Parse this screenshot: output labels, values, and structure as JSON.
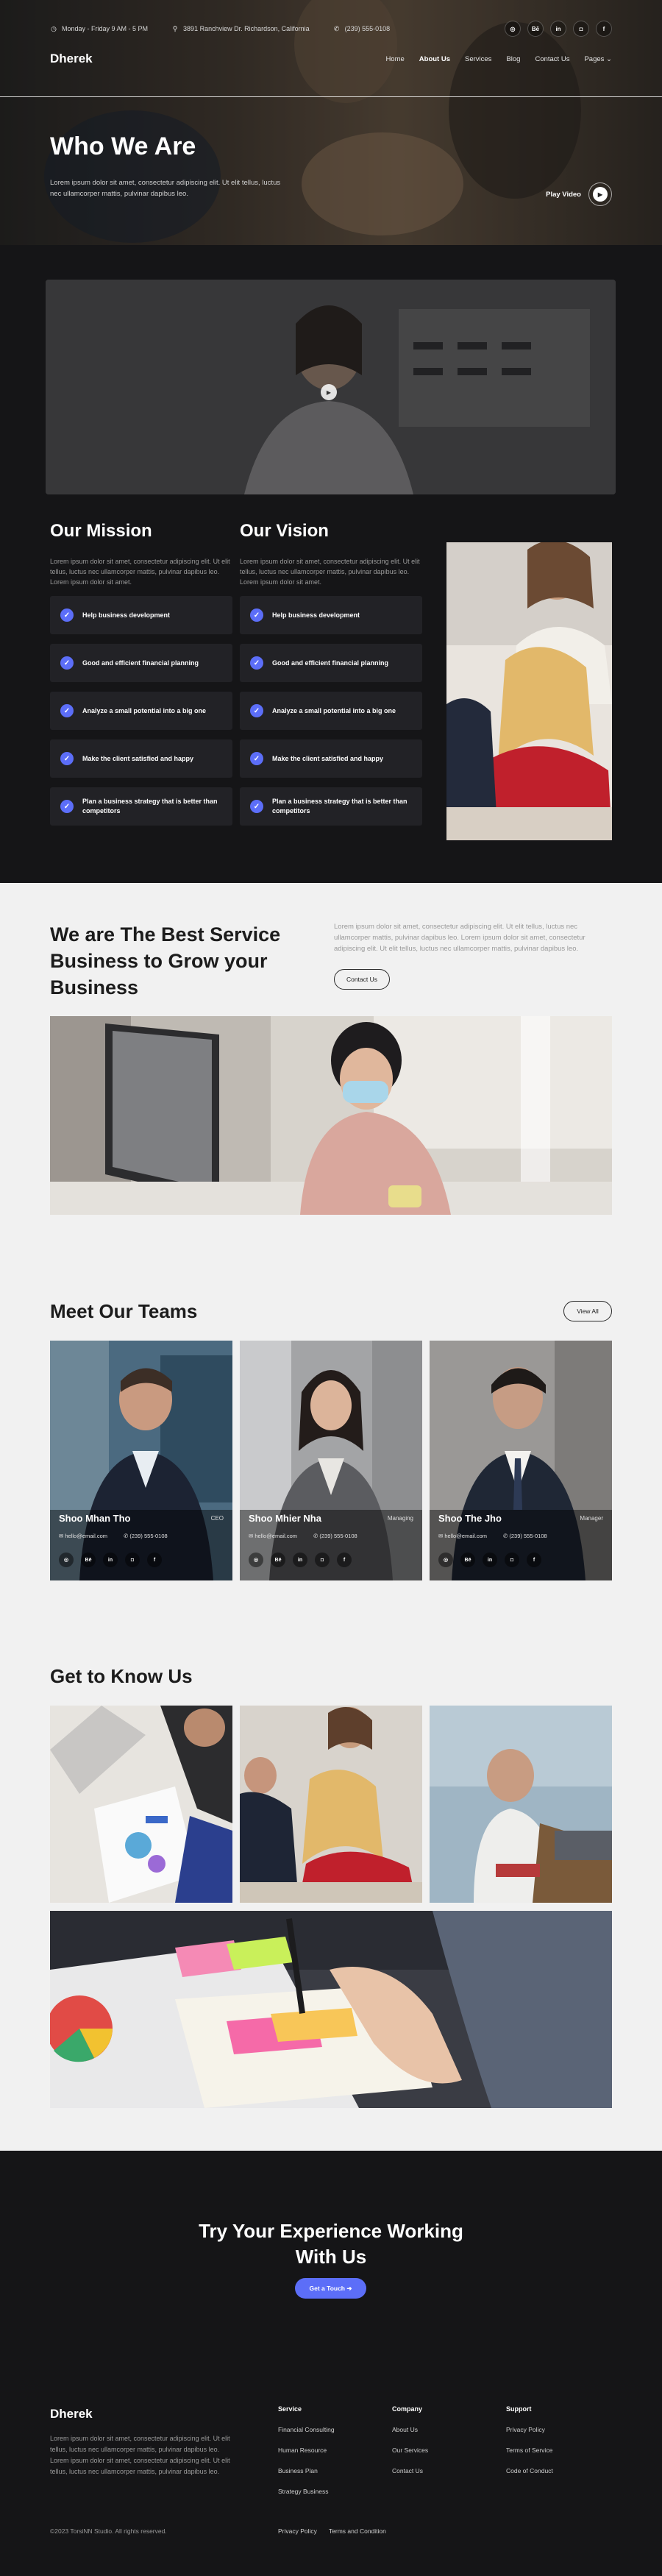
{
  "topbar": {
    "hours": "Monday - Friday 9 AM - 5 PM",
    "address": "3891 Ranchview Dr. Richardson, California",
    "phone": "(239) 555-0108",
    "socials": [
      "dribbble-icon",
      "behance-icon",
      "linkedin-icon",
      "instagram-icon",
      "facebook-icon"
    ],
    "social_glyphs": [
      "◎",
      "Bē",
      "in",
      "◘",
      "f"
    ]
  },
  "nav": {
    "logo": "Dherek",
    "items": [
      {
        "label": "Home",
        "active": false
      },
      {
        "label": "About Us",
        "active": true
      },
      {
        "label": "Services",
        "active": false
      },
      {
        "label": "Blog",
        "active": false
      },
      {
        "label": "Contact Us",
        "active": false
      },
      {
        "label": "Pages ⌄",
        "active": false
      }
    ]
  },
  "hero": {
    "title": "Who We Are",
    "description": "Lorem ipsum dolor sit amet, consectetur adipiscing elit. Ut elit tellus, luctus nec ullamcorper mattis, pulvinar dapibus leo.",
    "play_label": "Play Video"
  },
  "mission": {
    "title": "Our Mission",
    "text": "Lorem ipsum dolor sit amet, consectetur adipiscing elit. Ut elit tellus, luctus nec ullamcorper mattis, pulvinar dapibus leo. Lorem ipsum dolor sit amet.",
    "items": [
      "Help business development",
      "Good and efficient financial planning",
      "Analyze a small potential into a big one",
      "Make the client satisfied and happy",
      "Plan a business strategy that is better than competitors"
    ]
  },
  "vision": {
    "title": "Our Vision",
    "text": "Lorem ipsum dolor sit amet, consectetur adipiscing elit. Ut elit tellus, luctus nec ullamcorper mattis, pulvinar dapibus leo. Lorem ipsum dolor sit amet.",
    "items": [
      "Help business development",
      "Good and efficient financial planning",
      "Analyze a small potential into a big one",
      "Make the client satisfied and happy",
      "Plan a business strategy that is better than competitors"
    ]
  },
  "best": {
    "title": "We are The Best Service Business to Grow your Business",
    "description": "Lorem ipsum dolor sit amet, consectetur adipiscing elit. Ut elit tellus, luctus nec ullamcorper mattis, pulvinar dapibus leo. Lorem ipsum dolor sit amet, consectetur adipiscing elit. Ut elit tellus, luctus nec ullamcorper mattis, pulvinar dapibus leo.",
    "button": "Contact Us"
  },
  "teams": {
    "title": "Meet Our Teams",
    "view_all": "View All",
    "members": [
      {
        "name": "Shoo Mhan Tho",
        "role": "CEO",
        "email": "hello@email.com",
        "phone": "(239) 555-0108"
      },
      {
        "name": "Shoo Mhier Nha",
        "role": "Managing",
        "email": "hello@email.com",
        "phone": "(239) 555-0108"
      },
      {
        "name": "Shoo The Jho",
        "role": "Manager",
        "email": "hello@email.com",
        "phone": "(239) 555-0108"
      }
    ]
  },
  "know": {
    "title": "Get to Know Us"
  },
  "cta": {
    "title_line1": "Try Your Experience Working",
    "title_line2": "With Us",
    "button": "Get a Touch ➜"
  },
  "footer": {
    "logo": "Dherek",
    "description": "Lorem ipsum dolor sit amet, consectetur adipiscing elit. Ut elit tellus, luctus nec ullamcorper mattis, pulvinar dapibus leo. Lorem ipsum dolor sit amet, consectetur adipiscing elit. Ut elit tellus, luctus nec ullamcorper mattis, pulvinar dapibus leo.",
    "columns": [
      {
        "title": "Service",
        "links": [
          "Financial Consulting",
          "Human Resource",
          "Business Plan",
          "Strategy Business"
        ]
      },
      {
        "title": "Company",
        "links": [
          "About Us",
          "Our Services",
          "Contact Us"
        ]
      },
      {
        "title": "Support",
        "links": [
          "Privacy Policy",
          "Terms of Service",
          "Code of Conduct"
        ]
      }
    ],
    "copyright": "©2023 TorsiNN Studio. All rights reserved.",
    "privacy": "Privacy Policy",
    "terms": "Terms and Condition"
  },
  "colors": {
    "accent": "#5c6ef8",
    "dark": "#151517",
    "light": "#f1f1f1"
  }
}
